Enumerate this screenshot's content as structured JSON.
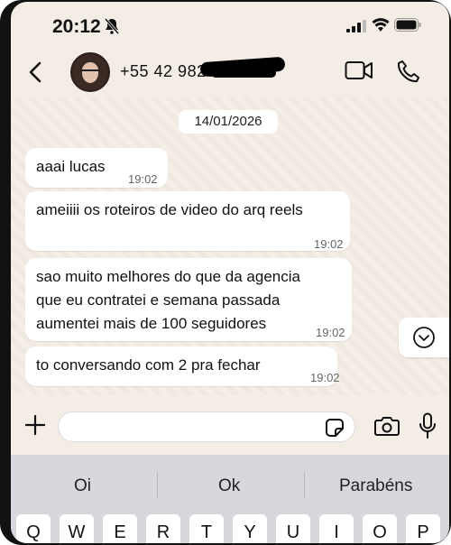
{
  "status_bar": {
    "time": "20:12"
  },
  "header": {
    "contact_name": "+55 42 98234-5012"
  },
  "chat": {
    "date": "14/01/2026",
    "messages": [
      {
        "text": "aaai lucas",
        "time": "19:02"
      },
      {
        "text": "ameiiii os roteiros de video do arq reels",
        "time": "19:02"
      },
      {
        "text": "sao muito melhores do que da agencia\nque eu contratei e semana passada\naumentei mais de 100 seguidores",
        "time": "19:02"
      },
      {
        "text": "to conversando com 2 pra fechar",
        "time": "19:02"
      }
    ]
  },
  "composer": {
    "value": "",
    "placeholder": ""
  },
  "suggestions": [
    "Oi",
    "Ok",
    "Parabéns"
  ],
  "keyboard": {
    "row1": [
      "Q",
      "W",
      "E",
      "R",
      "T",
      "Y",
      "U",
      "I",
      "O",
      "P"
    ]
  },
  "colors": {
    "background": "#f4ede6",
    "bubble": "#ffffff",
    "keyboard": "#d6d8de",
    "text": "#111111",
    "time": "#666666"
  },
  "icons": [
    "bell-off-icon",
    "signal-icon",
    "wifi-icon",
    "battery-icon",
    "back-arrow-icon",
    "video-call-icon",
    "phone-icon",
    "chevron-down-icon",
    "plus-icon",
    "sticker-icon",
    "camera-icon",
    "microphone-icon"
  ]
}
